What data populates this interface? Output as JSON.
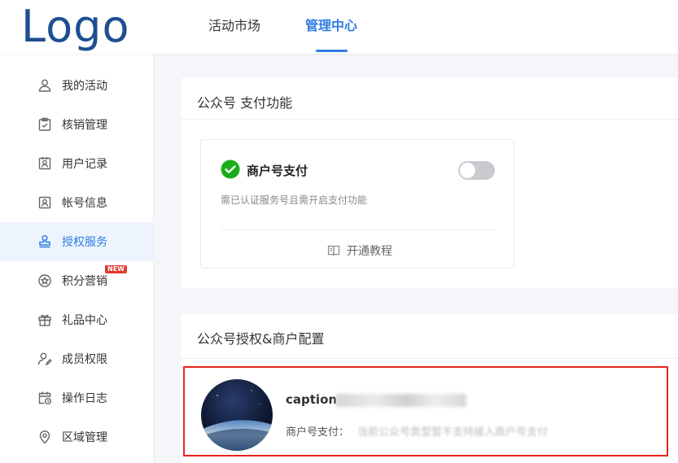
{
  "header": {
    "logo": "Logo",
    "tabs": [
      {
        "label": "活动市场",
        "active": false
      },
      {
        "label": "管理中心",
        "active": true
      }
    ]
  },
  "sidebar": {
    "items": [
      {
        "label": "我的活动",
        "icon": "user-icon"
      },
      {
        "label": "核销管理",
        "icon": "clipboard-check-icon"
      },
      {
        "label": "用户记录",
        "icon": "user-card-icon"
      },
      {
        "label": "帐号信息",
        "icon": "id-card-icon"
      },
      {
        "label": "授权服务",
        "icon": "stamp-icon",
        "active": true
      },
      {
        "label": "积分营销",
        "icon": "star-circle-icon",
        "badge": "NEW"
      },
      {
        "label": "礼品中心",
        "icon": "gift-icon"
      },
      {
        "label": "成员权限",
        "icon": "user-permission-icon"
      },
      {
        "label": "操作日志",
        "icon": "calendar-log-icon"
      },
      {
        "label": "区域管理",
        "icon": "location-icon"
      }
    ]
  },
  "payment_card": {
    "title": "公众号 支付功能",
    "feature_title": "商户号支付",
    "feature_desc": "需已认证服务号且需开启支付功能",
    "toggle_on": false,
    "tutorial_label": "开通教程"
  },
  "auth_card": {
    "title": "公众号授权&商户配置",
    "account_name": "caption",
    "merchant_label": "商户号支付：",
    "merchant_value": "当前公众号类型暂不支持接入商户号支付"
  },
  "colors": {
    "accent": "#2f7de1",
    "logo": "#1d4f91",
    "highlight_border": "#e8231e",
    "wechat_green": "#1aad19",
    "badge_red": "#e03a2f"
  }
}
